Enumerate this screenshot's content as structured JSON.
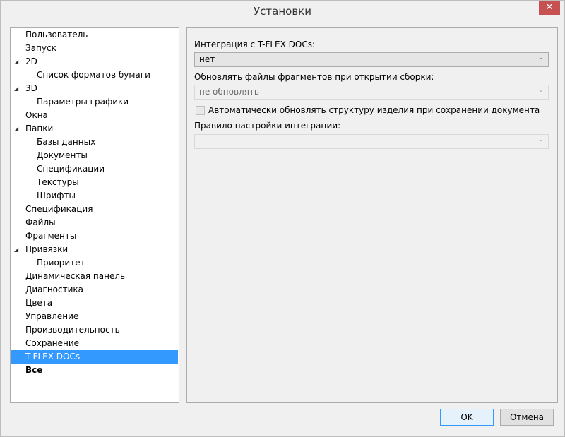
{
  "window": {
    "title": "Установки",
    "close_icon": "✕"
  },
  "tree": {
    "items": [
      {
        "label": "Пользователь",
        "level": 0,
        "arrow": ""
      },
      {
        "label": "Запуск",
        "level": 0,
        "arrow": ""
      },
      {
        "label": "2D",
        "level": 0,
        "arrow": "◢"
      },
      {
        "label": "Список форматов бумаги",
        "level": 1,
        "arrow": ""
      },
      {
        "label": "3D",
        "level": 0,
        "arrow": "◢"
      },
      {
        "label": "Параметры графики",
        "level": 1,
        "arrow": ""
      },
      {
        "label": "Окна",
        "level": 0,
        "arrow": ""
      },
      {
        "label": "Папки",
        "level": 0,
        "arrow": "◢"
      },
      {
        "label": "Базы данных",
        "level": 1,
        "arrow": ""
      },
      {
        "label": "Документы",
        "level": 1,
        "arrow": ""
      },
      {
        "label": "Спецификации",
        "level": 1,
        "arrow": ""
      },
      {
        "label": "Текстуры",
        "level": 1,
        "arrow": ""
      },
      {
        "label": "Шрифты",
        "level": 1,
        "arrow": ""
      },
      {
        "label": "Спецификация",
        "level": 0,
        "arrow": ""
      },
      {
        "label": "Файлы",
        "level": 0,
        "arrow": ""
      },
      {
        "label": "Фрагменты",
        "level": 0,
        "arrow": ""
      },
      {
        "label": "Привязки",
        "level": 0,
        "arrow": "◢"
      },
      {
        "label": "Приоритет",
        "level": 1,
        "arrow": ""
      },
      {
        "label": "Динамическая панель",
        "level": 0,
        "arrow": ""
      },
      {
        "label": "Диагностика",
        "level": 0,
        "arrow": ""
      },
      {
        "label": "Цвета",
        "level": 0,
        "arrow": ""
      },
      {
        "label": "Управление",
        "level": 0,
        "arrow": ""
      },
      {
        "label": "Производительность",
        "level": 0,
        "arrow": ""
      },
      {
        "label": "Сохранение",
        "level": 0,
        "arrow": ""
      },
      {
        "label": "T-FLEX DOCs",
        "level": 0,
        "arrow": "",
        "selected": true
      },
      {
        "label": "Все",
        "level": 0,
        "arrow": "",
        "bold": true
      }
    ]
  },
  "panel": {
    "integration_label": "Интеграция с T-FLEX DOCs:",
    "integration_value": "нет",
    "update_label": "Обновлять файлы фрагментов при открытии сборки:",
    "update_value": "не обновлять",
    "auto_update_label": "Автоматически обновлять структуру изделия при сохранении документа",
    "rule_label": "Правило настройки интеграции:",
    "rule_value": ""
  },
  "buttons": {
    "ok": "OK",
    "cancel": "Отмена"
  },
  "icons": {
    "dropdown": "⌄"
  }
}
